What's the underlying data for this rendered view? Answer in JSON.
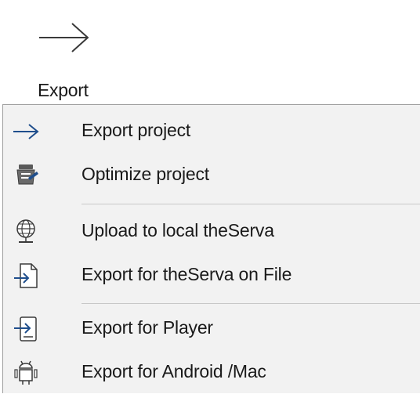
{
  "ribbon": {
    "export_label": "Export",
    "icon": "arrow-right-icon"
  },
  "menu": {
    "items": [
      {
        "label": "Export project",
        "icon": "arrow-right-icon"
      },
      {
        "label": "Optimize project",
        "icon": "optimize-icon"
      },
      {
        "label": "Upload to local theServa",
        "icon": "globe-network-icon"
      },
      {
        "label": "Export for theServa on File",
        "icon": "file-export-icon"
      },
      {
        "label": "Export for Player",
        "icon": "device-export-icon"
      },
      {
        "label": "Export for Android /Mac",
        "icon": "android-icon"
      }
    ]
  },
  "colors": {
    "menu_bg": "#f2f2f2",
    "icon_blue": "#1f4e8c",
    "icon_gray": "#4a4a4a"
  }
}
